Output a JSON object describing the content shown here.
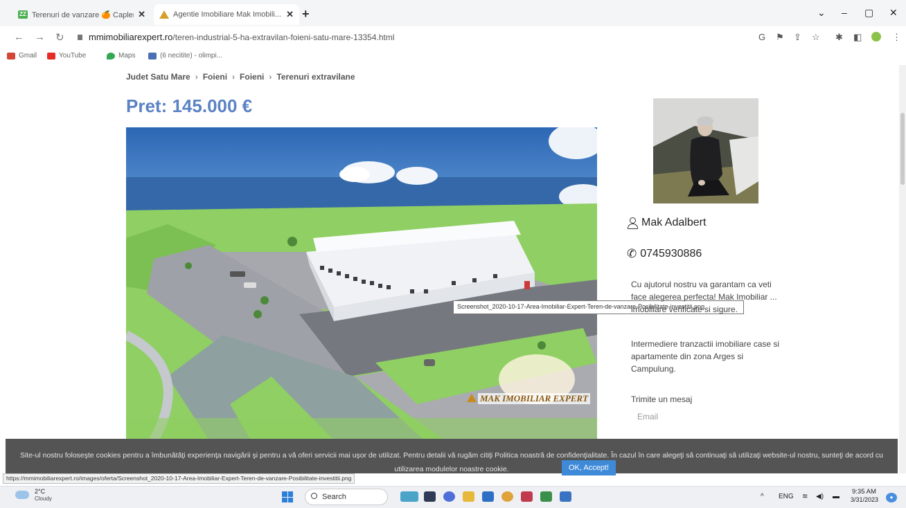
{
  "browser": {
    "tabs": [
      {
        "label": "Terenuri de vanzare 🍊 Capleni (",
        "favicon": "zz-icon"
      },
      {
        "label": "Agentie Imobiliare Mak Imobili...",
        "favicon": "mak-icon"
      }
    ],
    "url_host": "mmimobiliarexpert.ro",
    "url_path": "/teren-industrial-5-ha-extravilan-foieni-satu-mare-13354.html",
    "bookmarks": [
      "Gmail",
      "YouTube",
      "Maps",
      "(6 necitite) - olimpi..."
    ]
  },
  "page": {
    "breadcrumbs": [
      "Judet Satu Mare",
      "Foieni",
      "Foieni",
      "Terenuri extravilane"
    ],
    "price": "Pret: 145.000 €",
    "image_tooltip": "Screenshot_2020-10-17-Area-Imobiliar-Expert-Teren-de-vanzare-Posibilitate-investitii.png",
    "watermark": "MAK IMOBILIAR EXPERT",
    "agent": {
      "name": "Mak Adalbert",
      "phone": "0745930886",
      "desc1": "Cu ajutorul nostru va garantam ca veti face alegerea perfecta! Mak Imobiliar ... imobiliare verificate si sigure.",
      "desc2": "Intermediere tranzactii imobiliare case si apartamente din zona Arges si Campulung."
    },
    "message_label": "Trimite un mesaj",
    "email_placeholder": "Email"
  },
  "cookie_banner": {
    "text": "Site-ul nostru foloseşte cookies pentru a îmbunătăţi experienţa navigării şi pentru a vă oferi servicii mai uşor de utilizat. Pentru detalii vă rugăm citiţi Politica noastră de confidenţialitate. În cazul în care alegeţi să continuaţi să utilizaţi website-ul nostru, sunteţi de acord cu utilizarea modulelor noastre cookie.",
    "accept_label": "OK, Accept!"
  },
  "status_url": "https://mmimobiliarexpert.ro/images/oferta/Screenshot_2020-10-17-Area-Imobiliar-Expert-Teren-de-vanzare-Posibilitate-investitii.png",
  "taskbar": {
    "temp": "2°C",
    "condition": "Cloudy",
    "search_label": "Search",
    "lang": "ENG",
    "time": "9:35 AM",
    "date": "3/31/2023"
  },
  "colors": {
    "price_blue": "#5b82c4",
    "cookie_bg": "#545454",
    "accept_blue": "#3f8ad8"
  }
}
